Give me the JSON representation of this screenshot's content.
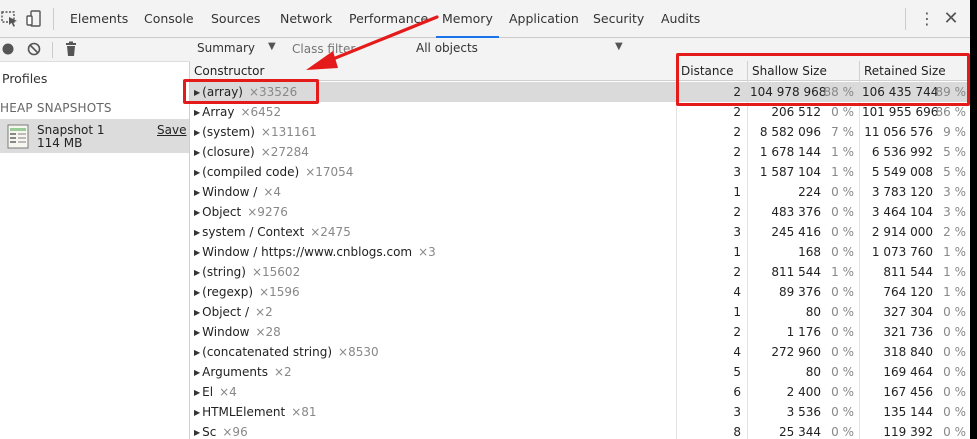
{
  "tabs": [
    "Elements",
    "Console",
    "Sources",
    "Network",
    "Performance",
    "Memory",
    "Application",
    "Security",
    "Audits"
  ],
  "active_tab": "Memory",
  "sidebar": {
    "profiles_label": "Profiles",
    "heap_title": "HEAP SNAPSHOTS",
    "snapshot": {
      "name": "Snapshot 1",
      "size": "114 MB",
      "save_label": "Save"
    }
  },
  "toolbar": {
    "view_select": "Summary",
    "class_filter_placeholder": "Class filter",
    "objects_select": "All objects"
  },
  "columns": {
    "constructor": "Constructor",
    "distance": "Distance",
    "shallow": "Shallow Size",
    "retained": "Retained Size"
  },
  "rows": [
    {
      "name": "(array)",
      "count": "×33526",
      "distance": "2",
      "shallow": "104 978 968",
      "shallow_pct": "88 %",
      "retained": "106 435 744",
      "retained_pct": "89 %"
    },
    {
      "name": "Array",
      "count": "×6452",
      "distance": "2",
      "shallow": "206 512",
      "shallow_pct": "0 %",
      "retained": "101 955 696",
      "retained_pct": "86 %"
    },
    {
      "name": "(system)",
      "count": "×131161",
      "distance": "2",
      "shallow": "8 582 096",
      "shallow_pct": "7 %",
      "retained": "11 056 576",
      "retained_pct": "9 %"
    },
    {
      "name": "(closure)",
      "count": "×27284",
      "distance": "2",
      "shallow": "1 678 144",
      "shallow_pct": "1 %",
      "retained": "6 536 992",
      "retained_pct": "5 %"
    },
    {
      "name": "(compiled code)",
      "count": "×17054",
      "distance": "3",
      "shallow": "1 587 104",
      "shallow_pct": "1 %",
      "retained": "5 549 008",
      "retained_pct": "5 %"
    },
    {
      "name": "Window /",
      "count": "×4",
      "distance": "1",
      "shallow": "224",
      "shallow_pct": "0 %",
      "retained": "3 783 120",
      "retained_pct": "3 %"
    },
    {
      "name": "Object",
      "count": "×9276",
      "distance": "2",
      "shallow": "483 376",
      "shallow_pct": "0 %",
      "retained": "3 464 104",
      "retained_pct": "3 %"
    },
    {
      "name": "system / Context",
      "count": "×2475",
      "distance": "3",
      "shallow": "245 416",
      "shallow_pct": "0 %",
      "retained": "2 914 000",
      "retained_pct": "2 %"
    },
    {
      "name": "Window / https://www.cnblogs.com",
      "count": "×3",
      "distance": "1",
      "shallow": "168",
      "shallow_pct": "0 %",
      "retained": "1 073 760",
      "retained_pct": "1 %"
    },
    {
      "name": "(string)",
      "count": "×15602",
      "distance": "2",
      "shallow": "811 544",
      "shallow_pct": "1 %",
      "retained": "811 544",
      "retained_pct": "1 %"
    },
    {
      "name": "(regexp)",
      "count": "×1596",
      "distance": "4",
      "shallow": "89 376",
      "shallow_pct": "0 %",
      "retained": "764 120",
      "retained_pct": "1 %"
    },
    {
      "name": "Object /",
      "count": "×2",
      "distance": "1",
      "shallow": "80",
      "shallow_pct": "0 %",
      "retained": "327 304",
      "retained_pct": "0 %"
    },
    {
      "name": "Window",
      "count": "×28",
      "distance": "2",
      "shallow": "1 176",
      "shallow_pct": "0 %",
      "retained": "321 736",
      "retained_pct": "0 %"
    },
    {
      "name": "(concatenated string)",
      "count": "×8530",
      "distance": "4",
      "shallow": "272 960",
      "shallow_pct": "0 %",
      "retained": "318 840",
      "retained_pct": "0 %"
    },
    {
      "name": "Arguments",
      "count": "×2",
      "distance": "5",
      "shallow": "80",
      "shallow_pct": "0 %",
      "retained": "169 464",
      "retained_pct": "0 %"
    },
    {
      "name": "El",
      "count": "×4",
      "distance": "6",
      "shallow": "2 400",
      "shallow_pct": "0 %",
      "retained": "167 456",
      "retained_pct": "0 %"
    },
    {
      "name": "HTMLElement",
      "count": "×81",
      "distance": "3",
      "shallow": "3 536",
      "shallow_pct": "0 %",
      "retained": "135 144",
      "retained_pct": "0 %"
    },
    {
      "name": "Sc",
      "count": "×96",
      "distance": "8",
      "shallow": "25 344",
      "shallow_pct": "0 %",
      "retained": "119 392",
      "retained_pct": "0 %"
    }
  ],
  "colors": {
    "annotation": "#e51a1a",
    "selected_row": "#dadada",
    "toolbar_bg": "#f3f3f3",
    "active_tab_underline": "#1a73e8"
  }
}
